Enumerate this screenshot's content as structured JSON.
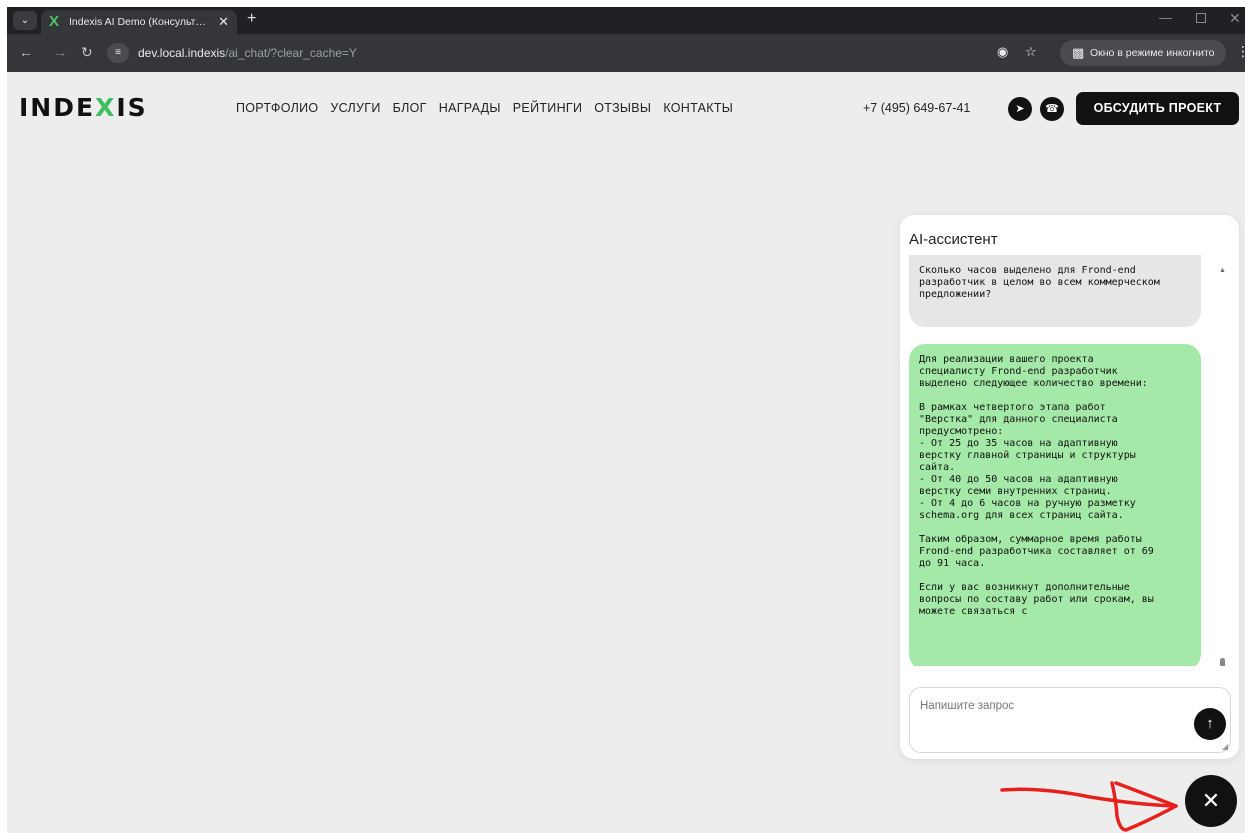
{
  "browser": {
    "tab_title": "Indexis AI Demo (Консультант",
    "tab_favicon": "X",
    "new_tab_glyph": "+",
    "url_host": "dev.local.indexis",
    "url_path": "/ai_chat/?clear_cache=Y",
    "incognito_label": "Окно в режиме инкогнито",
    "icons": [
      "tab-search-icon",
      "back-icon",
      "forward-icon",
      "reload-icon",
      "site-info-icon",
      "eye-off-icon",
      "star-icon",
      "incognito-icon",
      "kebab-menu-icon"
    ]
  },
  "site": {
    "logo": {
      "before": "INDE",
      "mark": "X",
      "after": "IS"
    },
    "nav": [
      "ПОРТФОЛИО",
      "УСЛУГИ",
      "БЛОГ",
      "НАГРАДЫ",
      "РЕЙТИНГИ",
      "ОТЗЫВЫ",
      "КОНТАКТЫ"
    ],
    "phone": "+7 (495) 649-67-41",
    "cta": "ОБСУДИТЬ ПРОЕКТ"
  },
  "chat": {
    "title": "AI-ассистент",
    "messages": [
      {
        "role": "user",
        "text": "Сколько часов выделено для Frond-end\nразработчик в целом во всем коммерческом\nпредложении?"
      },
      {
        "role": "assistant",
        "text": "Для реализации вашего проекта\nспециалисту Frond-end разработчик\nвыделено следующее количество времени:\n\nВ рамках четвертого этапа работ\n\"Верстка\" для данного специалиста\nпредусмотрено:\n- От 25 до 35 часов на адаптивную\nверстку главной страницы и структуры\nсайта.\n- От 40 до 50 часов на адаптивную\nверстку семи внутренних страниц.\n- От 4 до 6 часов на ручную разметку\nschema.org для всех страниц сайта.\n\nТаким образом, суммарное время работы\nFrond-end разработчика составляет от 69\nдо 91 часа.\n\nЕсли у вас возникнут дополнительные\nвопросы по составу работ или срокам, вы\nможете связаться с"
      }
    ],
    "input_placeholder": "Напишите запрос",
    "input_value": ""
  },
  "colors": {
    "brand_green": "#3fbf5f",
    "user_bubble": "#e6e6e6",
    "assistant_bubble": "#a4e9a7",
    "annotation_red": "#e8201c"
  }
}
